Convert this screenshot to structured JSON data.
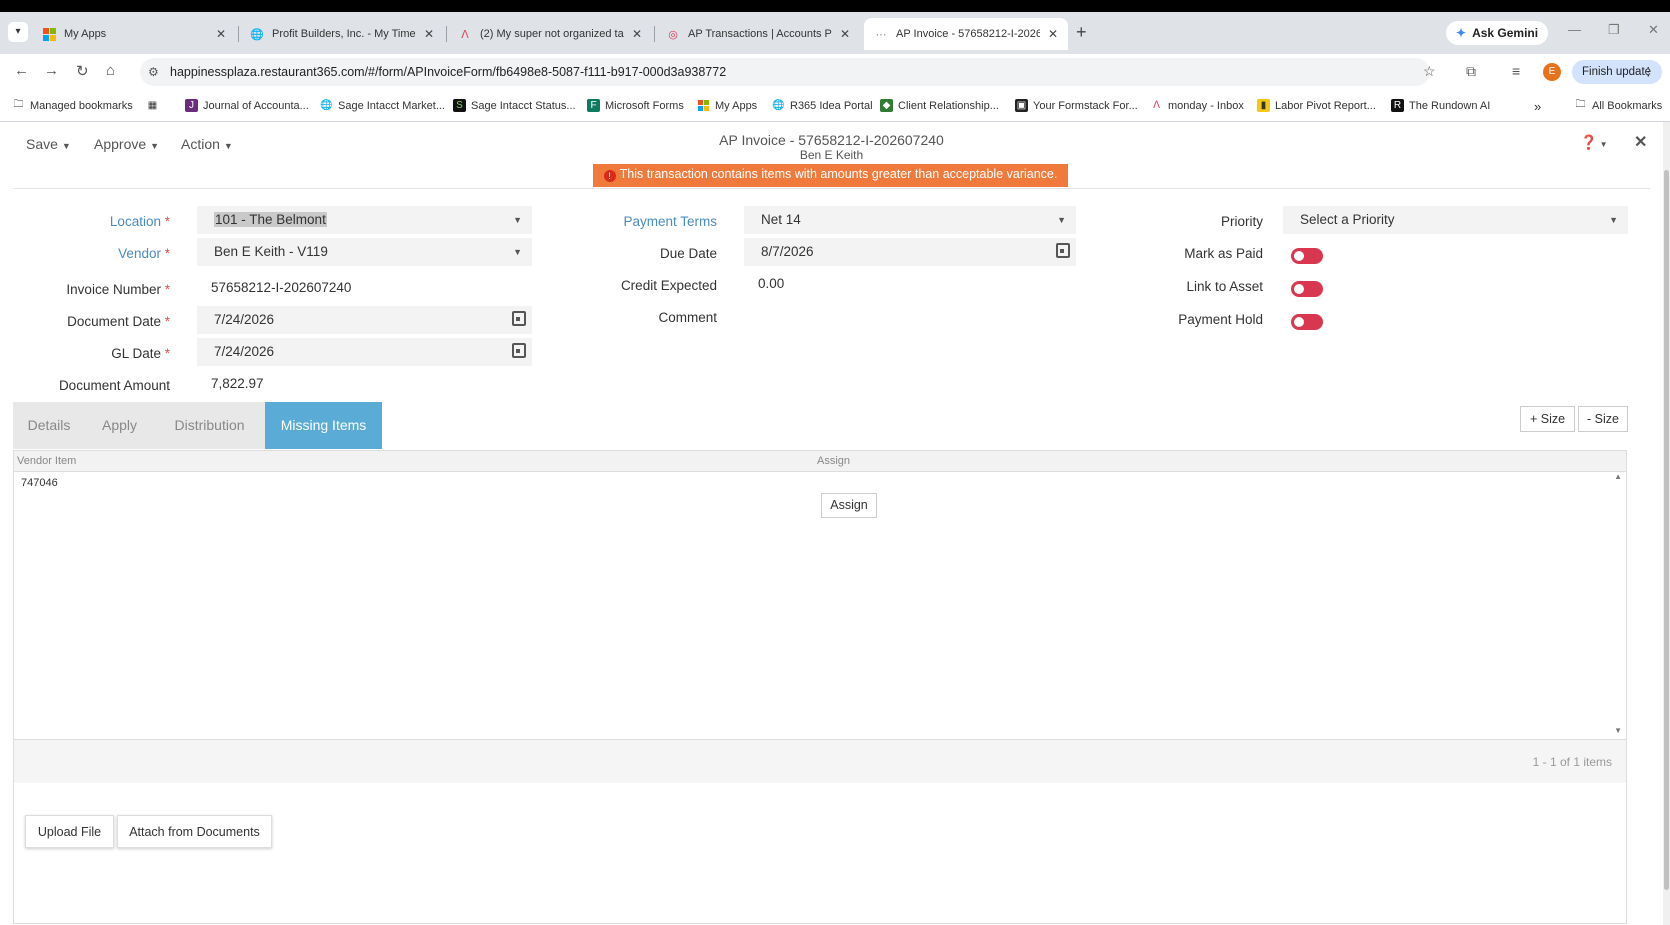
{
  "browser": {
    "tabs": [
      {
        "title": "My Apps"
      },
      {
        "title": "Profit Builders, Inc. - My Time"
      },
      {
        "title": "(2) My super not organized tas"
      },
      {
        "title": "AP Transactions | Accounts Pay"
      },
      {
        "title": "AP Invoice - 57658212-I-20260"
      }
    ],
    "ask_gemini": "Ask Gemini",
    "url": "happinessplaza.restaurant365.com/#/form/APInvoiceForm/fb6498e8-5087-f111-b917-000d3a938772",
    "profile_initial": "E",
    "finish_update": "Finish update",
    "bookmarks": [
      "Managed bookmarks",
      "Journal of Accounta...",
      "Sage Intacct Market...",
      "Sage Intacct Status...",
      "Microsoft Forms",
      "My Apps",
      "R365 Idea Portal",
      "Client Relationship...",
      "Your Formstack For...",
      "monday - Inbox",
      "Labor Pivot Report...",
      "The Rundown AI"
    ],
    "all_bookmarks": "All Bookmarks"
  },
  "form": {
    "menu": {
      "save": "Save",
      "approve": "Approve",
      "action": "Action"
    },
    "title": "AP Invoice - 57658212-I-202607240",
    "subtitle": "Ben E Keith",
    "alert": "This transaction contains items with amounts greater than acceptable variance.",
    "fields": {
      "location_label": "Location",
      "location_value": "101 - The Belmont",
      "vendor_label": "Vendor",
      "vendor_value": "Ben E Keith - V119",
      "invoice_number_label": "Invoice Number",
      "invoice_number_value": "57658212-I-202607240",
      "document_date_label": "Document Date",
      "document_date_value": "7/24/2026",
      "gl_date_label": "GL Date",
      "gl_date_value": "7/24/2026",
      "document_amount_label": "Document Amount",
      "document_amount_value": "7,822.97",
      "payment_terms_label": "Payment Terms",
      "payment_terms_value": "Net 14",
      "due_date_label": "Due Date",
      "due_date_value": "8/7/2026",
      "credit_expected_label": "Credit Expected",
      "credit_expected_value": "0.00",
      "comment_label": "Comment",
      "priority_label": "Priority",
      "priority_value": "Select a Priority",
      "mark_as_paid_label": "Mark as Paid",
      "link_to_asset_label": "Link to Asset",
      "payment_hold_label": "Payment Hold"
    },
    "tabs": [
      "Details",
      "Apply",
      "Distribution",
      "Missing Items"
    ],
    "active_tab": "Missing Items",
    "size_plus": "+ Size",
    "size_minus": "- Size",
    "grid": {
      "columns": [
        "Vendor Item",
        "Assign"
      ],
      "rows": [
        {
          "vendor_item": "747046",
          "assign": "Assign"
        }
      ],
      "footer": "1 - 1 of 1 items"
    },
    "upload_file": "Upload File",
    "attach_from_documents": "Attach from Documents"
  },
  "colors": {
    "accent_tab": "#5aacd6",
    "alert": "#f07a3c",
    "toggle_off": "#d9364f",
    "link_label": "#4a8bc2"
  }
}
